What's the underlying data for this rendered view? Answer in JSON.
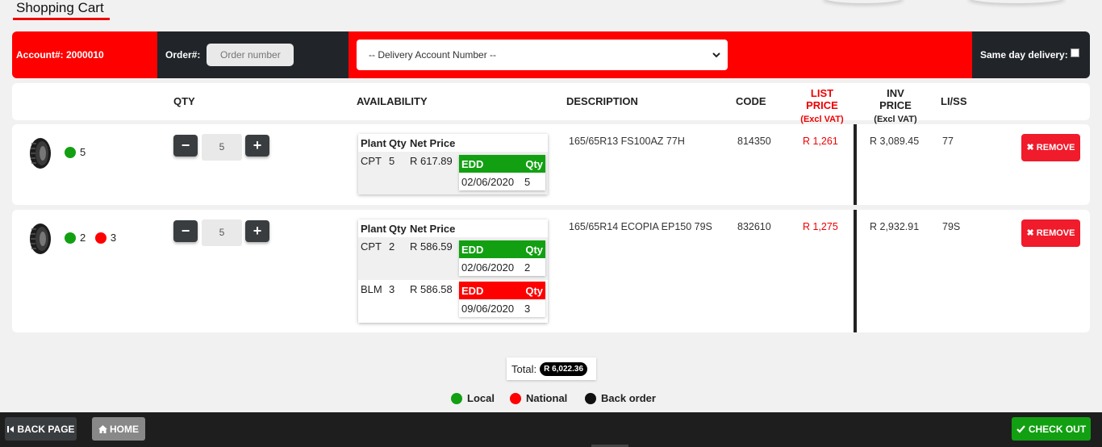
{
  "page": {
    "title": "Shopping Cart"
  },
  "bar": {
    "account_label": "Account#: 2000010",
    "order_label": "Order#:",
    "order_placeholder": "Order number",
    "delivery_select": "-- Delivery Account Number --",
    "same_day_label": "Same day delivery:"
  },
  "headers": {
    "qty": "QTY",
    "availability": "AVAILABILITY",
    "description": "DESCRIPTION",
    "code": "CODE",
    "list_price": "LIST PRICE",
    "list_price_sub": "(Excl VAT)",
    "inv_price": "INV PRICE",
    "inv_price_sub": "(Excl VAT)",
    "liss": "LI/SS"
  },
  "avail_headers": {
    "plant": "Plant",
    "qty": "Qty",
    "net_price": "Net Price",
    "edd": "EDD",
    "edd_qty": "Qty"
  },
  "items": [
    {
      "green_count": "5",
      "qty": "5",
      "stock": [
        {
          "plant": "CPT",
          "qty": "5",
          "net_price": "R 617.89",
          "edd": "02/06/2020",
          "edd_qty": "5",
          "status": "local"
        }
      ],
      "description": "165/65R13 FS100AZ 77H",
      "code": "814350",
      "list_price": "R 1,261",
      "inv_price": "R 3,089.45",
      "liss": "77",
      "remove_label": "REMOVE"
    },
    {
      "green_count": "2",
      "red_count": "3",
      "qty": "5",
      "stock": [
        {
          "plant": "CPT",
          "qty": "2",
          "net_price": "R 586.59",
          "edd": "02/06/2020",
          "edd_qty": "2",
          "status": "local"
        },
        {
          "plant": "BLM",
          "qty": "3",
          "net_price": "R 586.58",
          "edd": "09/06/2020",
          "edd_qty": "3",
          "status": "national"
        }
      ],
      "description": "165/65R14 ECOPIA EP150 79S",
      "code": "832610",
      "list_price": "R 1,275",
      "inv_price": "R 2,932.91",
      "liss": "79S",
      "remove_label": "REMOVE"
    }
  ],
  "total": {
    "label": "Total:",
    "value": "R 6,022.36"
  },
  "legend": {
    "local": "Local",
    "national": "National",
    "back_order": "Back order"
  },
  "footer": {
    "back_label": "BACK PAGE",
    "home_label": "HOME",
    "checkout_label": "CHECK OUT"
  },
  "colors": {
    "accent": "#ff0000",
    "dark": "#212529",
    "local": "#12a012",
    "national": "#ff0000",
    "back_order": "#111111"
  },
  "icons": {
    "minus": "minus-icon",
    "plus": "plus-icon",
    "remove": "close-icon",
    "back": "skip-back-icon",
    "home": "home-icon",
    "checkout": "check-icon",
    "dropdown": "chevron-down-icon"
  }
}
